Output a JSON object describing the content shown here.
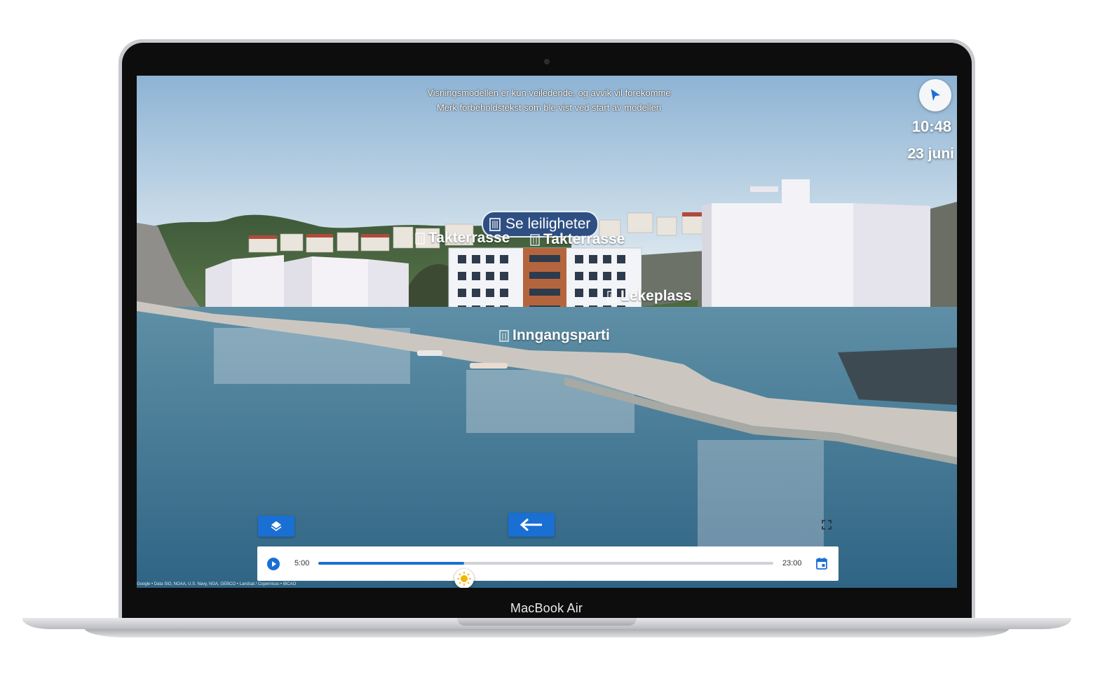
{
  "device": {
    "brand_label": "MacBook Air"
  },
  "viewer": {
    "disclaimer_line1": "Visningsmodellen er kun veiledende, og avvik vil forekomme",
    "disclaimer_line2": "Merk forbeholdstekst som ble vist ved start av modellen",
    "clock": "10:48",
    "date": "23 juni",
    "accent_color": "#1a6fd3"
  },
  "hotspots": {
    "main": {
      "label": "Se leiligheter",
      "icon": "building-icon"
    },
    "takterrasse_left": {
      "label": "Takterrasse",
      "icon": "building-icon"
    },
    "takterrasse_right": {
      "label": "Takterrasse",
      "icon": "building-icon"
    },
    "lekeplass": {
      "label": "Lekeplass",
      "icon": "building-icon"
    },
    "inngangsparti": {
      "label": "Inngangsparti",
      "icon": "building-icon"
    }
  },
  "controls": {
    "layers_icon": "layers-icon",
    "back_icon": "arrow-left-icon",
    "fullscreen_icon": "fullscreen-icon",
    "navigation_icon": "navigation-arrow-icon"
  },
  "timeline": {
    "start_label": "5:00",
    "end_label": "23:00",
    "progress": 0.32,
    "play_icon": "play-icon",
    "sun_icon": "sun-icon",
    "calendar_icon": "calendar-icon"
  },
  "map_credits": "Google • Data SIO, NOAA, U.S. Navy, NGA, GEBCO • Landsat / Copernicus • IBCAO"
}
